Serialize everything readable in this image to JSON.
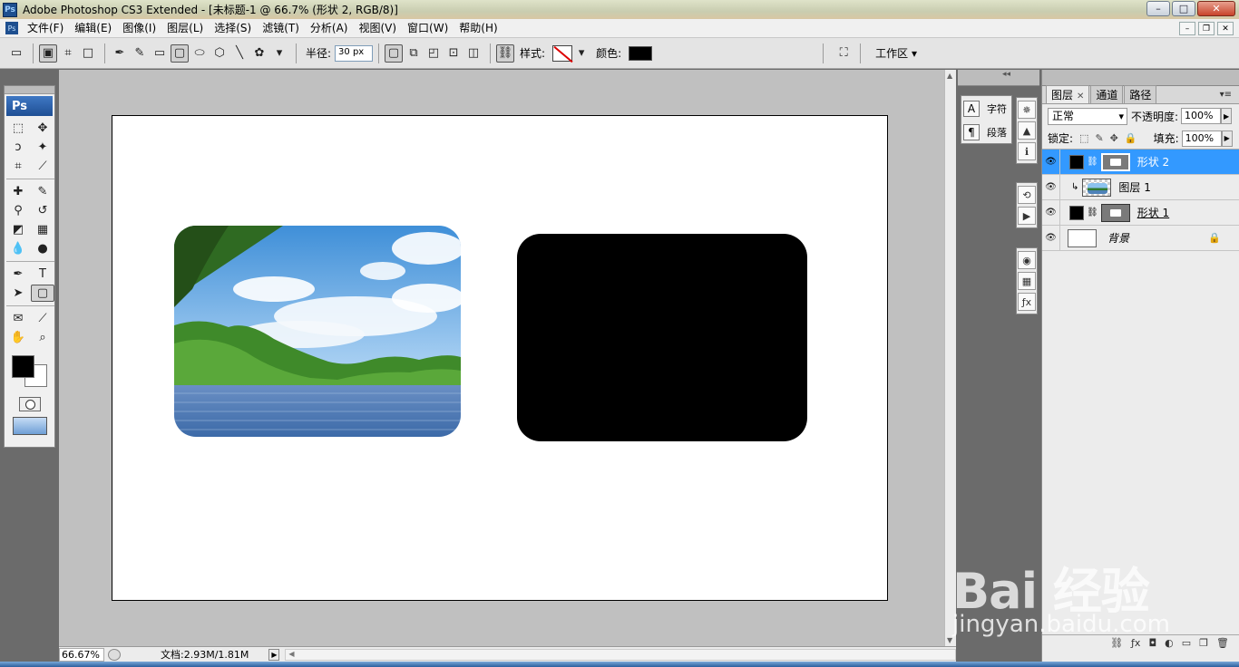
{
  "window": {
    "title": "Adobe Photoshop CS3 Extended - [未标题-1 @ 66.7% (形状 2, RGB/8)]",
    "logo": "Ps",
    "buttons": [
      "–",
      "□",
      "✕"
    ]
  },
  "menu": {
    "items": [
      "文件(F)",
      "编辑(E)",
      "图像(I)",
      "图层(L)",
      "选择(S)",
      "滤镜(T)",
      "分析(A)",
      "视图(V)",
      "窗口(W)",
      "帮助(H)"
    ],
    "doc_buttons": [
      "–",
      "❐",
      "✕"
    ]
  },
  "options": {
    "radius_label": "半径:",
    "radius_value": "30 px",
    "style_label": "样式:",
    "color_label": "颜色:",
    "color_value": "#000000",
    "workspace_label": "工作区 ▾"
  },
  "tools": {
    "header": "Ps",
    "foreground": "#000000",
    "background": "#ffffff"
  },
  "status": {
    "zoom": "66.67%",
    "doc_info": "文档:2.93M/1.81M"
  },
  "dock": {
    "character_label": "字符",
    "paragraph_label": "段落"
  },
  "layers_panel": {
    "tabs": [
      "图层",
      "通道",
      "路径"
    ],
    "blend_mode": "正常",
    "opacity_label": "不透明度:",
    "opacity_value": "100%",
    "lock_label": "锁定:",
    "fill_label": "填充:",
    "fill_value": "100%",
    "layers": [
      {
        "name": "形状 2",
        "selected": true
      },
      {
        "name": "图层 1",
        "selected": false
      },
      {
        "name": "形状 1",
        "selected": false
      },
      {
        "name": "背景",
        "selected": false
      }
    ]
  },
  "watermark": {
    "brand": "Bai 经验",
    "url": "jingyan.baidu.com"
  }
}
